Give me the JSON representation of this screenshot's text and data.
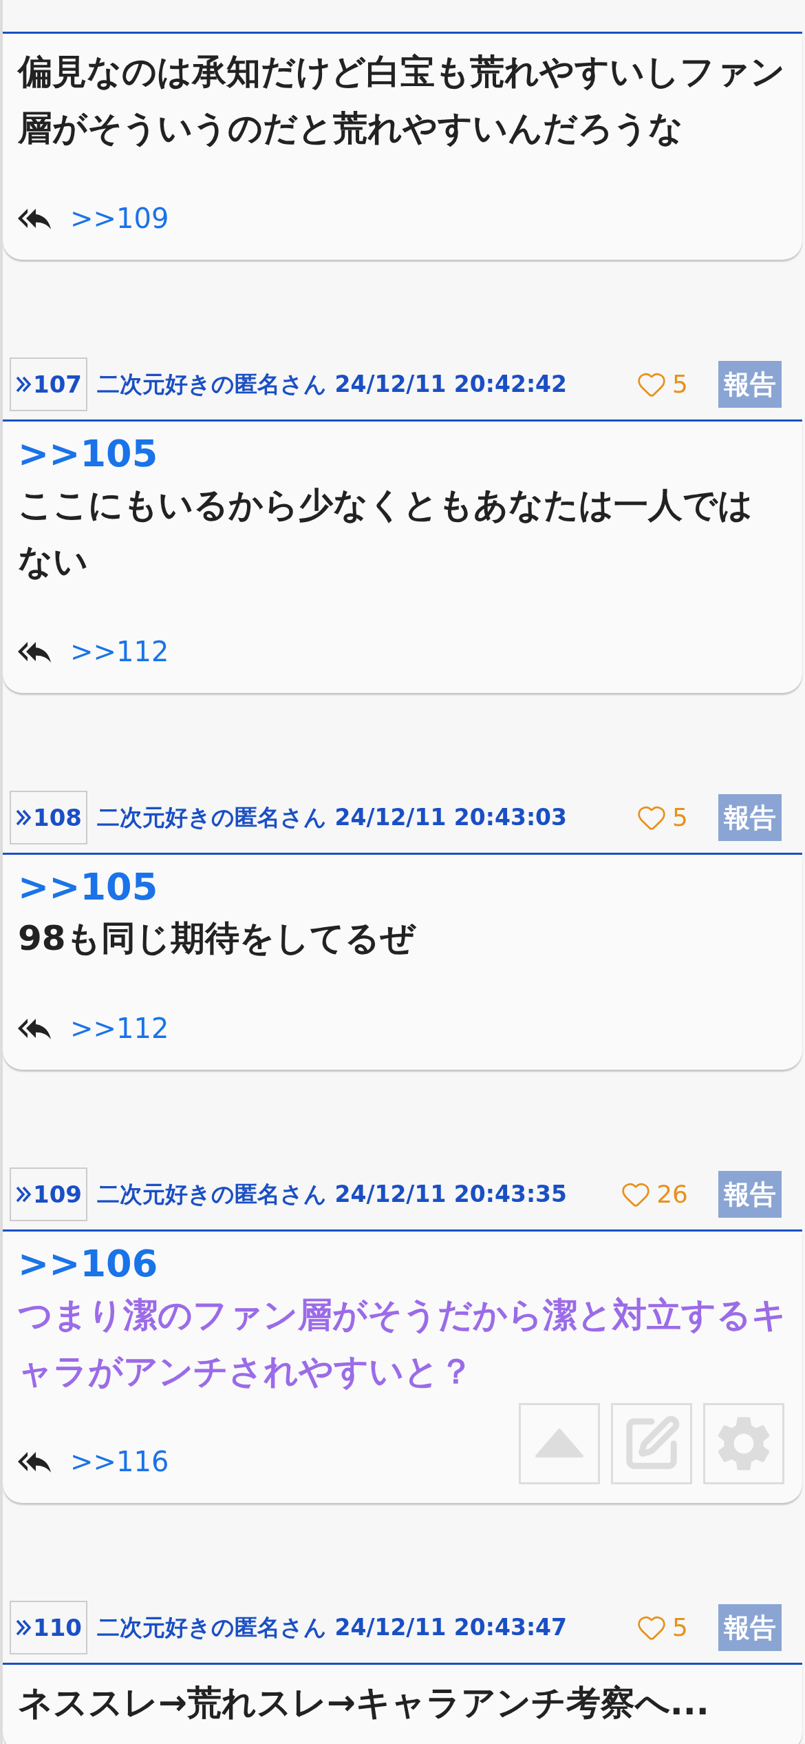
{
  "posts": [
    {
      "body": "偏見なのは承知だけど白宝も荒れやすいしファン層がそういうのだと荒れやすいんだろうな",
      "kind": "plain",
      "replies": [
        ">>109"
      ]
    },
    {
      "number": "107",
      "name": "二次元好きの匿名さん",
      "date": "24/12/11 20:42:42",
      "likes": "5",
      "report": "報告",
      "anchor": ">>105",
      "body": "ここにもいるから少なくともあなたは一人ではない",
      "kind": "plain",
      "replies": [
        ">>112"
      ]
    },
    {
      "number": "108",
      "name": "二次元好きの匿名さん",
      "date": "24/12/11 20:43:03",
      "likes": "5",
      "report": "報告",
      "anchor": ">>105",
      "body": "98も同じ期待をしてるぜ",
      "kind": "plain",
      "replies": [
        ">>112"
      ]
    },
    {
      "number": "109",
      "name": "二次元好きの匿名さん",
      "date": "24/12/11 20:43:35",
      "likes": "26",
      "report": "報告",
      "anchor": ">>106",
      "body": "つまり潔のファン層がそうだから潔と対立するキャラがアンチされやすいと？",
      "kind": "highlight",
      "replies": [
        ">>116"
      ]
    },
    {
      "number": "110",
      "name": "二次元好きの匿名さん",
      "date": "24/12/11 20:43:47",
      "likes": "5",
      "report": "報告",
      "body": "ネススレ→荒れスレ→キャラアンチ考察へ...",
      "kind": "plain"
    }
  ]
}
